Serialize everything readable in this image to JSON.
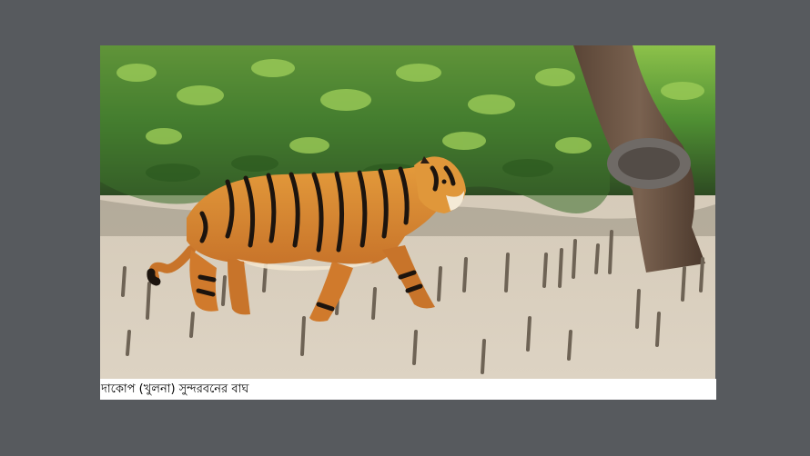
{
  "photo": {
    "caption": "দাকোপ (খুলনা) সুন্দরবনের বাঘ"
  },
  "colors": {
    "background": "#575a5e",
    "card": "#ffffff",
    "foliage": "#3f7a2c",
    "mud": "#d6ccbb",
    "tiger": "#d9822b"
  }
}
